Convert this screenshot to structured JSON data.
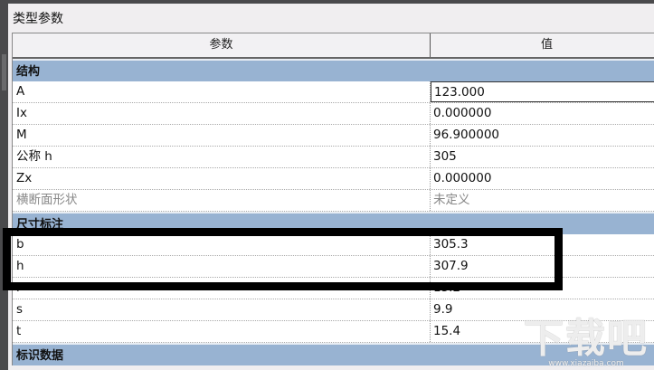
{
  "dialog": {
    "title": "类型参数"
  },
  "table": {
    "headers": [
      "参数",
      "值"
    ],
    "groups": [
      {
        "label": "结构",
        "rows": [
          {
            "name": "A",
            "value": "123.000"
          },
          {
            "name": "Ix",
            "value": "0.000000"
          },
          {
            "name": "M",
            "value": "96.900000"
          },
          {
            "name": "公称 h",
            "value": "305"
          },
          {
            "name": "Zx",
            "value": "0.000000"
          },
          {
            "name": "横断面形状",
            "value": "未定义"
          }
        ]
      },
      {
        "label": "尺寸标注",
        "rows": [
          {
            "name": "b",
            "value": "305.3"
          },
          {
            "name": "h",
            "value": "307.9"
          },
          {
            "name": "r",
            "value": "15.2"
          },
          {
            "name": "s",
            "value": "9.9"
          },
          {
            "name": "t",
            "value": "15.4"
          }
        ]
      },
      {
        "label": "标识数据",
        "rows": []
      }
    ]
  },
  "watermark": {
    "logo": "下载吧",
    "url": "www.xiazaiba.com"
  }
}
